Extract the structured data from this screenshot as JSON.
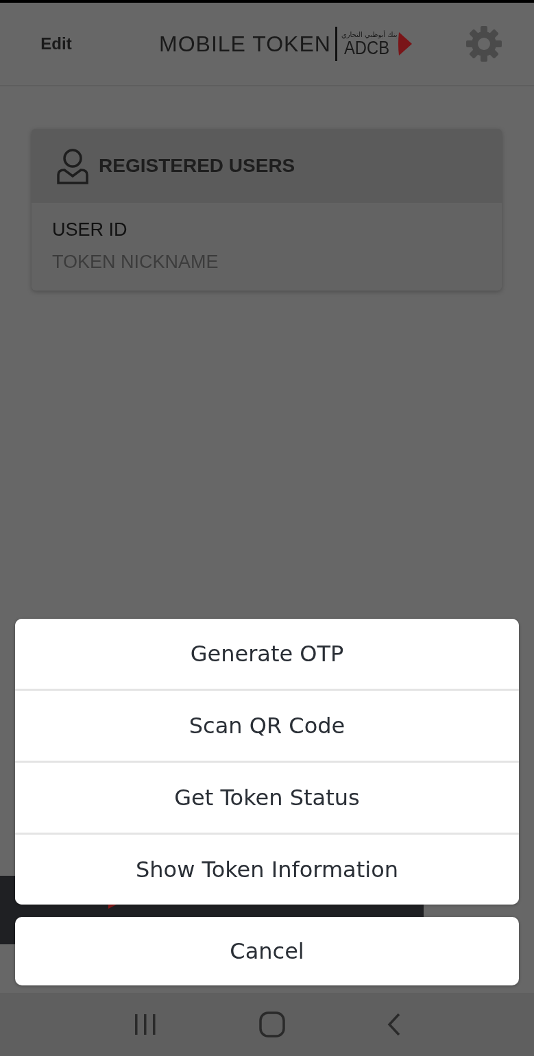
{
  "header": {
    "edit": "Edit",
    "title": "MOBILE TOKEN",
    "logo_text": "ADCB",
    "logo_arabic": "بنك أبوظبي التجاري"
  },
  "card": {
    "title": "REGISTERED USERS",
    "user_id": "USER ID",
    "nickname": "TOKEN NICKNAME"
  },
  "action_sheet": {
    "actions": [
      "Generate OTP",
      "Scan QR Code",
      "Get Token Status",
      "Show Token Information"
    ],
    "cancel": "Cancel"
  }
}
